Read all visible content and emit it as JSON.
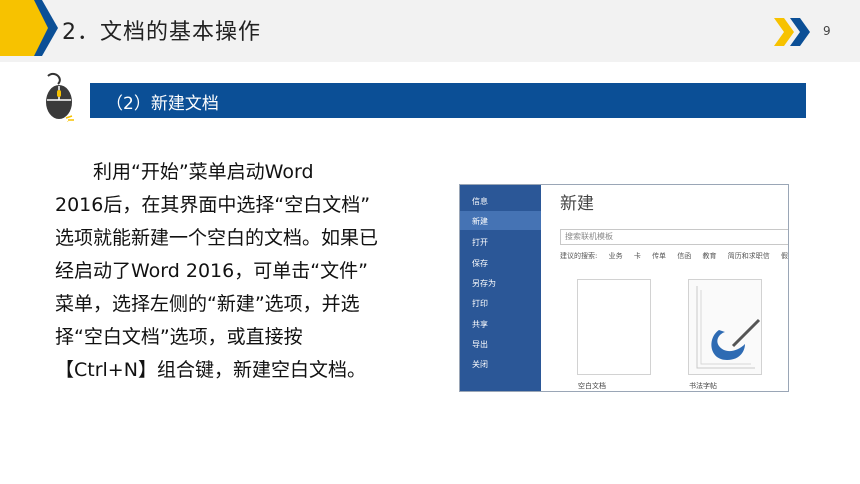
{
  "header": {
    "title": "2．文档的基本操作",
    "page_number": "9",
    "colors": {
      "yellow": "#f7c200",
      "blue": "#0b4f96",
      "header_bg": "#f2f2f2"
    }
  },
  "section": {
    "label": "（2）新建文档",
    "icon": "mouse-icon"
  },
  "paragraph": {
    "lines": [
      "利用“开始”菜单启动Word",
      "2016后，在其界面中选择“空白文档”",
      "选项就能新建一个空白的文档。如果已",
      "经启动了Word 2016，可单击“文件”",
      "菜单，选择左侧的“新建”选项，并选",
      "择“空白文档”选项，或直接按",
      "【Ctrl+N】组合键，新建空白文档。"
    ]
  },
  "screenshot": {
    "sidebar_items": [
      "信息",
      "新建",
      "打开",
      "保存",
      "另存为",
      "打印",
      "共享",
      "导出",
      "关闭"
    ],
    "active_item": "新建",
    "heading": "新建",
    "search_placeholder": "搜索联机模板",
    "suggested_label": "建议的搜索:",
    "suggested_terms": [
      "业务",
      "卡",
      "传单",
      "信函",
      "教育",
      "简历和求职信",
      "假日"
    ],
    "templates": [
      "空白文档",
      "书法字帖"
    ]
  }
}
